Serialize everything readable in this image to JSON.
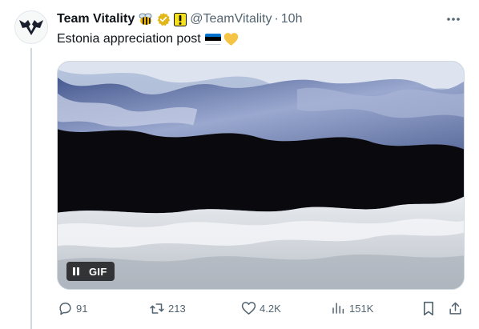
{
  "tweet": {
    "display_name": "Team Vitality",
    "handle": "@TeamVitality",
    "separator": "·",
    "time": "10h",
    "text": "Estonia appreciation post",
    "media": {
      "type": "gif",
      "badge_label": "GIF",
      "subject": "waving Estonian flag"
    }
  },
  "actions": {
    "replies": "91",
    "reposts": "213",
    "likes": "4.2K",
    "views": "151K"
  },
  "colors": {
    "text_primary": "#0f1419",
    "text_secondary": "#536471",
    "verified_gold": "#e2b719",
    "flag_blue": "#0072ce",
    "flag_black": "#000000",
    "flag_white": "#ffffff",
    "heart_yellow": "#f5c445",
    "divider": "#cfd9de"
  },
  "icons": [
    "bee-emoji-icon",
    "verified-badge-icon",
    "exclamation-badge-icon",
    "more-icon",
    "estonia-flag-icon",
    "yellow-heart-icon",
    "pause-icon",
    "reply-icon",
    "repost-icon",
    "like-icon",
    "views-icon",
    "bookmark-icon",
    "share-icon"
  ]
}
